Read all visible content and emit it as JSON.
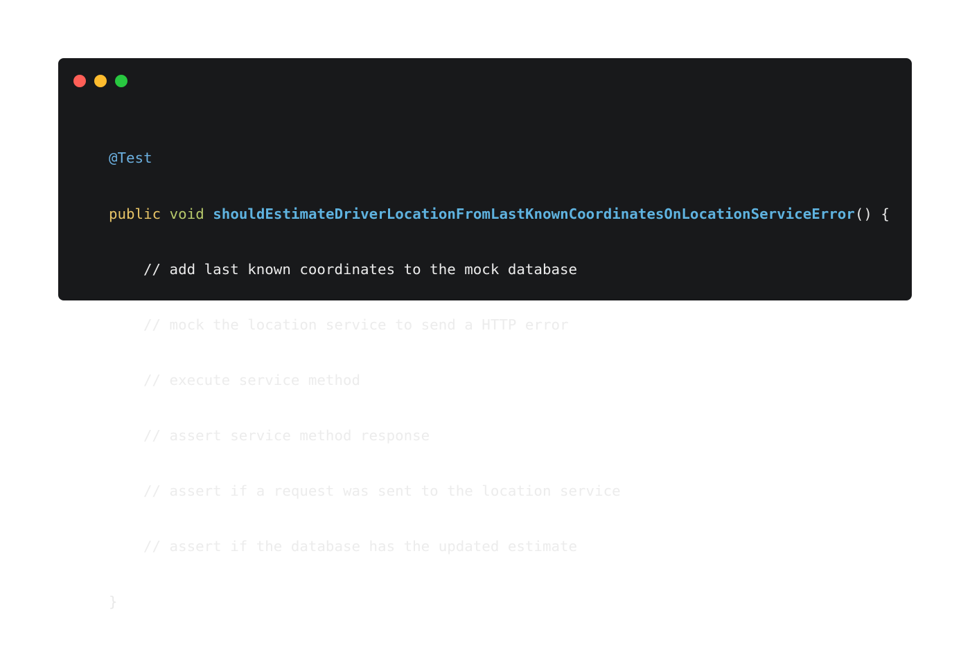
{
  "window": {
    "controls": [
      {
        "name": "close-button",
        "color": "#ff5f57"
      },
      {
        "name": "minimize-button",
        "color": "#febc2e"
      },
      {
        "name": "zoom-button",
        "color": "#28c840"
      }
    ]
  },
  "code": {
    "annotation": "@Test",
    "signature": {
      "modifier": "public",
      "return_type": "void",
      "method_name": "shouldEstimateDriverLocationFromLastKnownCoordinatesOnLocationServiceError",
      "params_open": "() {"
    },
    "comments": [
      "// add last known coordinates to the mock database",
      "// mock the location service to send a HTTP error",
      "// execute service method",
      "// assert service method response",
      "// assert if a request was sent to the location service",
      "// assert if the database has the updated estimate"
    ],
    "closing_brace": "}"
  },
  "colors": {
    "background": "#18191b",
    "annotation": "#6cb0e0",
    "keyword": "#e8c567",
    "type": "#b7c96b",
    "method": "#5fb3e0",
    "text": "#e8e8e8"
  }
}
